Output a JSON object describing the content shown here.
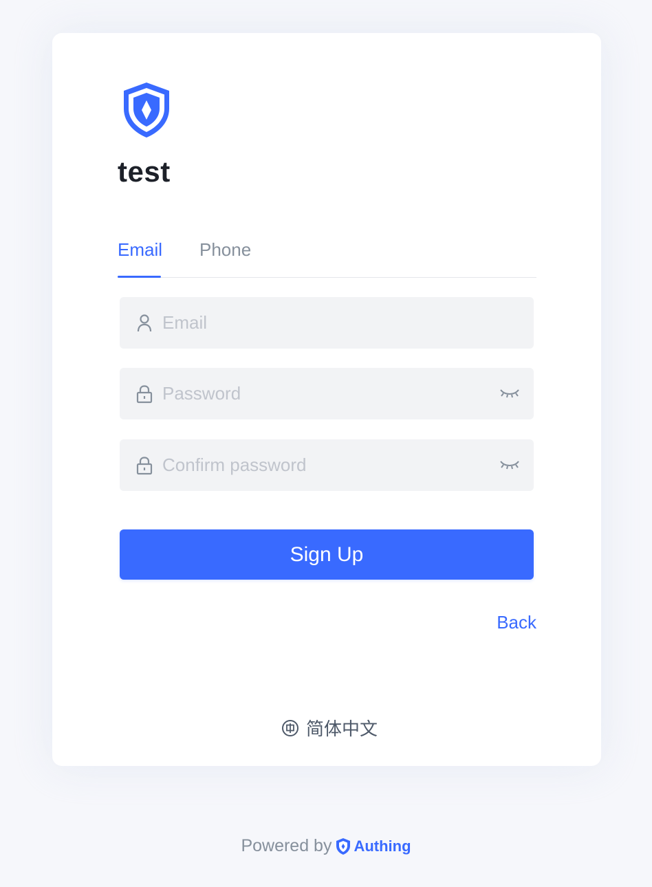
{
  "app": {
    "name": "test"
  },
  "tabs": [
    {
      "label": "Email",
      "active": true
    },
    {
      "label": "Phone",
      "active": false
    }
  ],
  "form": {
    "email": {
      "value": "",
      "placeholder": "Email"
    },
    "password": {
      "value": "",
      "placeholder": "Password"
    },
    "confirm_password": {
      "value": "",
      "placeholder": "Confirm password"
    },
    "submit_label": "Sign Up"
  },
  "back_label": "Back",
  "language": {
    "current": "简体中文",
    "icon": "globe-icon"
  },
  "footer": {
    "powered_by": "Powered by",
    "brand": "Authing"
  },
  "colors": {
    "accent": "#396aff",
    "input_bg": "#f2f3f5",
    "page_bg": "#f6f7fb"
  }
}
